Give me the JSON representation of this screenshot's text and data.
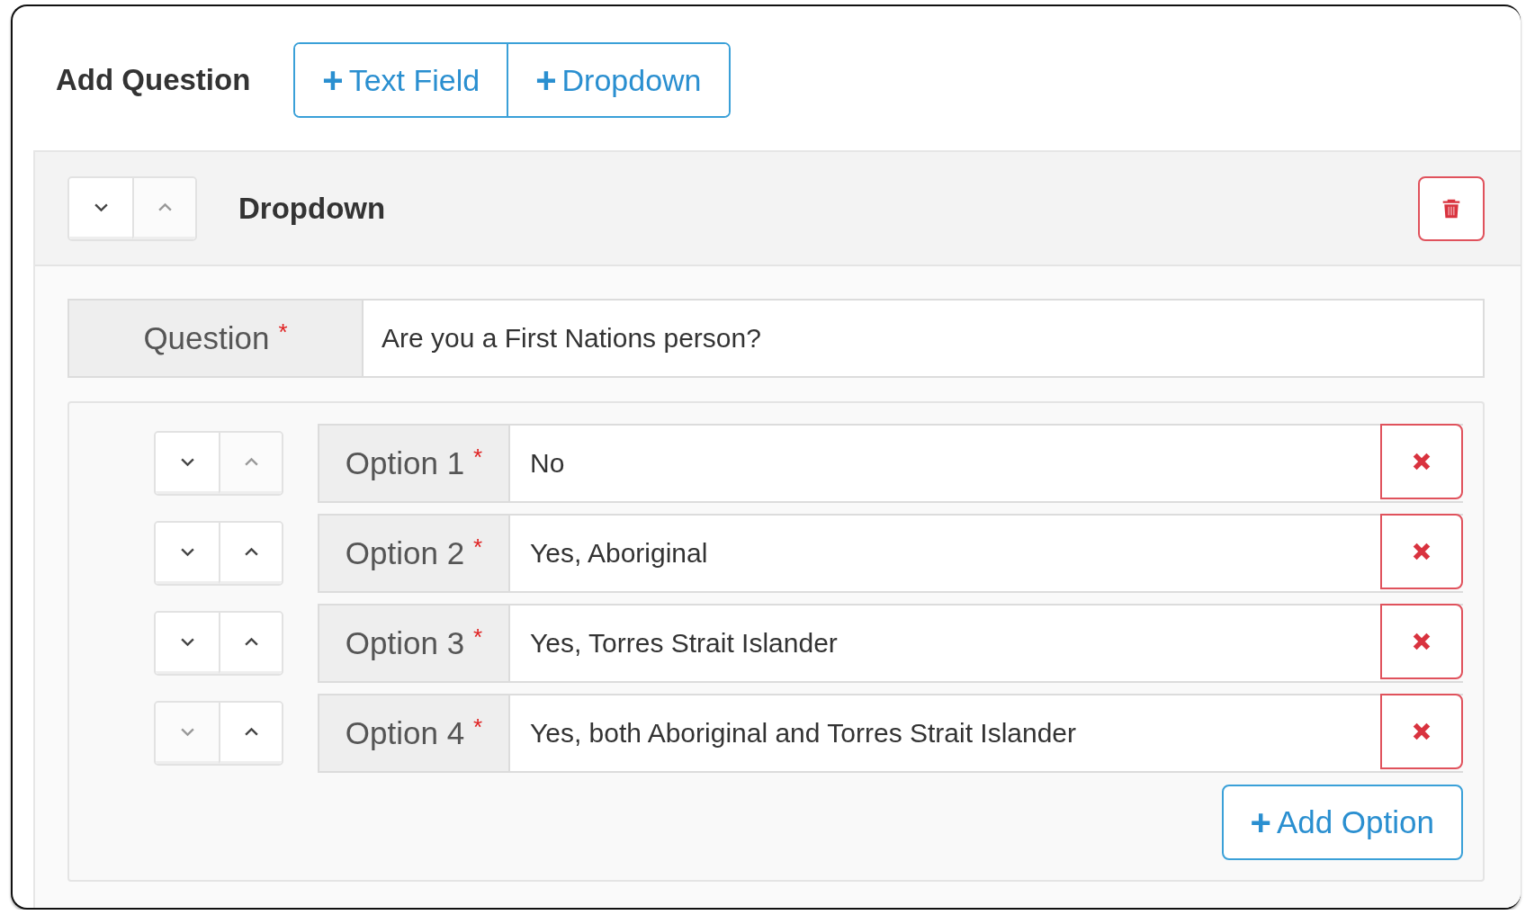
{
  "heading": "Add Question",
  "add_buttons": [
    {
      "icon": "+",
      "label": "Text Field"
    },
    {
      "icon": "+",
      "label": "Dropdown"
    }
  ],
  "question_block": {
    "title": "Dropdown",
    "move_down_disabled": false,
    "move_up_disabled": true,
    "question": {
      "label": "Question",
      "required_mark": "*",
      "value": "Are you a First Nations person?"
    },
    "options": [
      {
        "label": "Option 1",
        "required_mark": "*",
        "value": "No",
        "move_down_disabled": false,
        "move_up_disabled": true
      },
      {
        "label": "Option 2",
        "required_mark": "*",
        "value": "Yes, Aboriginal",
        "move_down_disabled": false,
        "move_up_disabled": false
      },
      {
        "label": "Option 3",
        "required_mark": "*",
        "value": "Yes, Torres Strait Islander",
        "move_down_disabled": false,
        "move_up_disabled": false
      },
      {
        "label": "Option 4",
        "required_mark": "*",
        "value": "Yes, both Aboriginal and Torres Strait Islander",
        "move_down_disabled": true,
        "move_up_disabled": false
      }
    ],
    "add_option": {
      "icon": "+",
      "label": "Add Option"
    }
  }
}
